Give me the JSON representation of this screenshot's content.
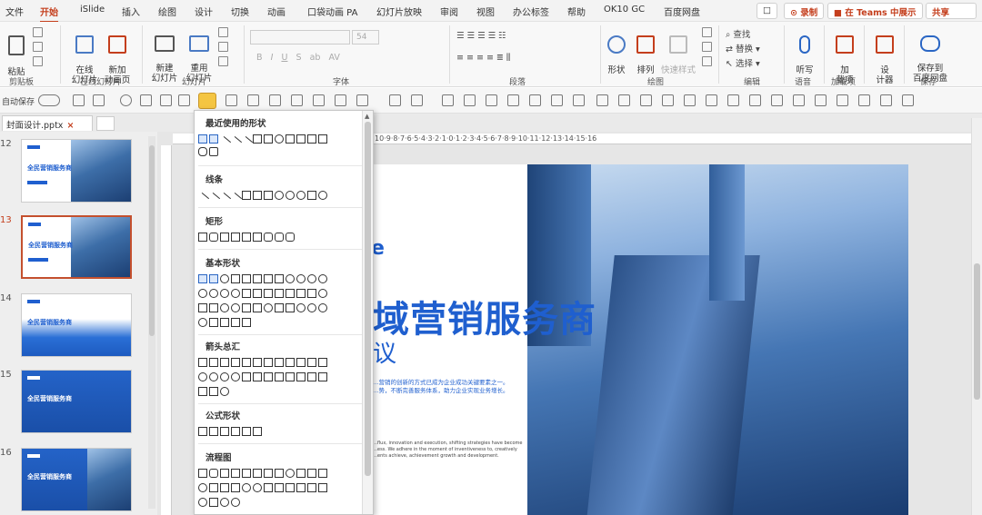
{
  "menubar": {
    "items": [
      "文件",
      "开始",
      "iSlide",
      "插入",
      "绘图",
      "设计",
      "切换",
      "动画",
      "口袋动画 PA",
      "幻灯片放映",
      "审阅",
      "视图",
      "办公标签",
      "帮助",
      "OK10 GC",
      "百度网盘"
    ],
    "active": "开始",
    "btn_comment": "□",
    "btn_record": "⊙ 录制",
    "btn_teams": "■ 在 Teams 中展示",
    "btn_share": "共享"
  },
  "ribbon": {
    "paste": "粘贴",
    "group_clipboard": "剪贴板",
    "online_slide": "在线\n幻灯片",
    "new_anim": "新加\n动画页",
    "group_online": "在线幻灯片",
    "new_slide": "新建\n幻灯片",
    "reuse": "重用\n幻灯片",
    "group_slides": "幻灯片",
    "font_size": "54",
    "group_font": "字体",
    "group_paragraph": "段落",
    "shape": "形状",
    "arrange": "排列",
    "quick_style": "快速样式",
    "group_drawing": "绘图",
    "find": "查找",
    "replace": "替换",
    "select": "选择",
    "group_edit": "编辑",
    "dictate": "听写",
    "group_voice": "语音",
    "addin": "加\n载项",
    "group_addin": "加载项",
    "design": "设\n计器",
    "save_baidu": "保存到\n百度网盘",
    "group_save": "保存",
    "autosave": "自动保存"
  },
  "doctab": {
    "name": "封面设计.pptx",
    "close": "×"
  },
  "slides": {
    "numbers": [
      "12",
      "13",
      "14",
      "15",
      "16"
    ],
    "active_index": 1,
    "thumb_title": "全民营销服务商"
  },
  "ruler": {
    "marks": "10·9·8·7·6·5·4·3·2·1·0·1·2·3·4·5·6·7·8·9·10·11·12·13·14·15·16"
  },
  "slide": {
    "tag": "e",
    "headline": "域营销服务商",
    "subline": "议",
    "desc1": "…营销的创新的方式已成为企业成功关键要素之一。",
    "desc2": "…势，不断完善服务体系，助力企业实现业务增长。",
    "en1": "…flux, innovation and execution, shifting strategies have become",
    "en2": "…ess. We adhere in the moment of inventiveness to, creatively",
    "en3": "…ents achieve, achievement growth and development."
  },
  "dropdown": {
    "recent": "最近使用的形状",
    "lines": "线条",
    "rect": "矩形",
    "basic": "基本形状",
    "arrows": "箭头总汇",
    "equation": "公式形状",
    "flowchart": "流程图"
  },
  "colors": {
    "accent": "#c43e1c",
    "slide_blue": "#1f5fcf"
  }
}
